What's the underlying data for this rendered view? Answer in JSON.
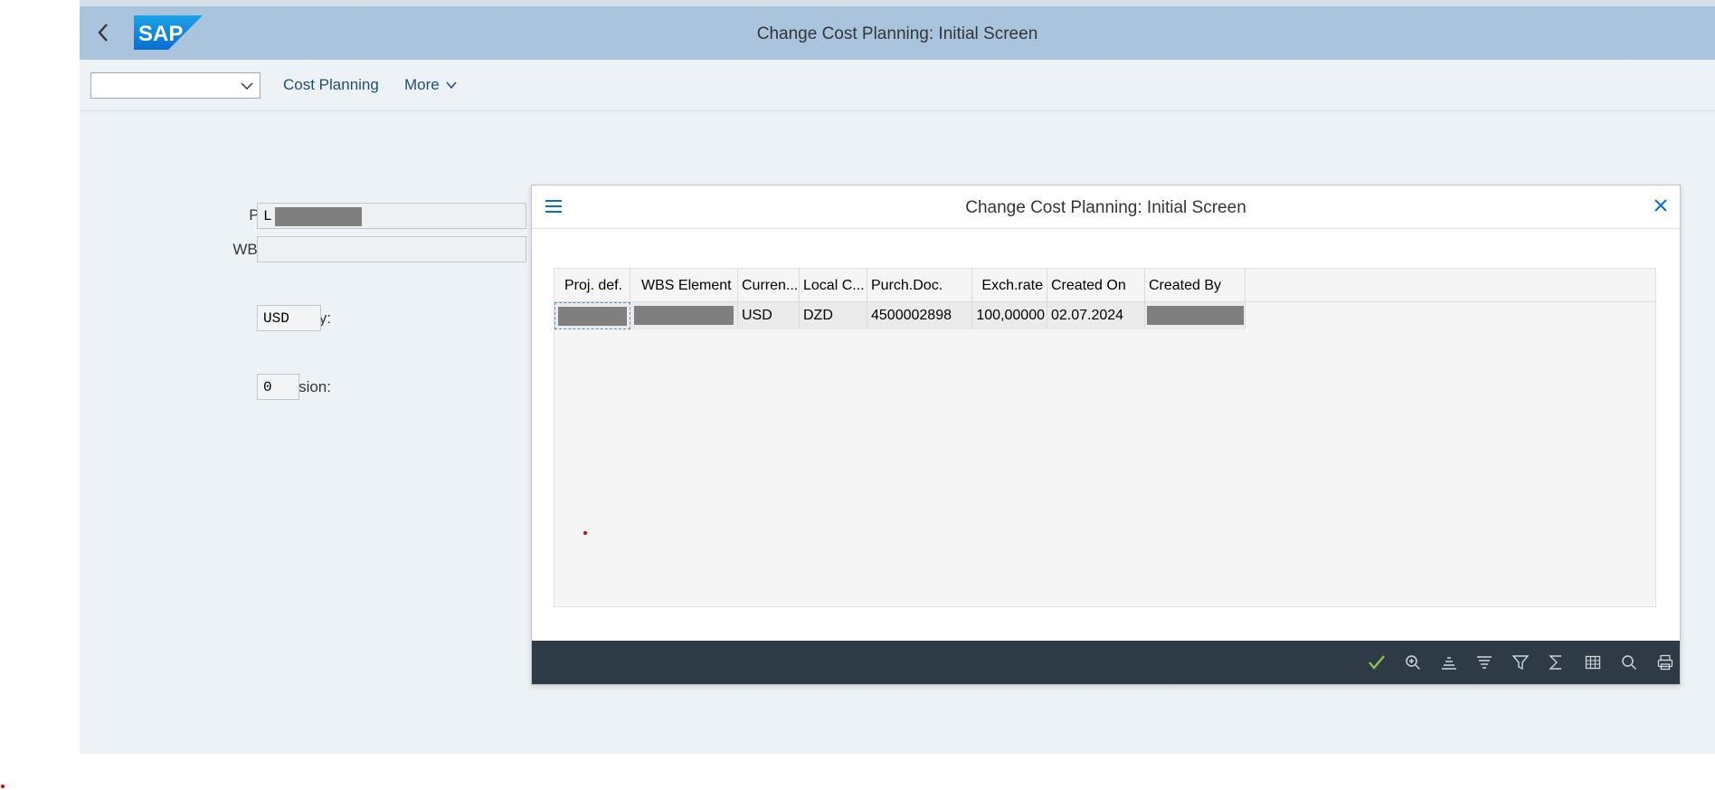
{
  "shell": {
    "title": "Change Cost Planning: Initial Screen"
  },
  "toolbar": {
    "command_value": "",
    "cost_planning_label": "Cost Planning",
    "more_label": "More"
  },
  "form": {
    "project_def_label": "Project def.:",
    "project_def_value": "L -",
    "wbs_label": "WBS element:",
    "wbs_value": "",
    "currency_label": "Currency:",
    "currency_value": "USD",
    "version_label": "Version:",
    "version_required_marker": "*",
    "version_value": "0"
  },
  "dialog": {
    "title": "Change Cost Planning: Initial Screen",
    "columns": [
      "Proj. def.",
      "WBS Element",
      "Curren...",
      "Local C...",
      "Purch.Doc.",
      "Exch.rate",
      "Created On",
      "Created By"
    ],
    "rows": [
      {
        "proj_def": "",
        "wbs_element": "",
        "currency": "USD",
        "local_currency": "DZD",
        "purch_doc": "4500002898",
        "exch_rate": "100,00000",
        "created_on": "02.07.2024",
        "created_by": ""
      }
    ],
    "footer_icons": [
      "checkmark-icon",
      "zoom-in-icon",
      "sort-ascending-icon",
      "sort-descending-icon",
      "filter-icon",
      "sum-icon",
      "table-settings-icon",
      "search-icon",
      "print-icon"
    ]
  },
  "colors": {
    "shell_bar": "#a9c4dc",
    "app_background": "#edf2f6",
    "dialog_footer": "#2e3a45",
    "link": "#1f4d7a",
    "accept_green": "#8bc34a"
  }
}
